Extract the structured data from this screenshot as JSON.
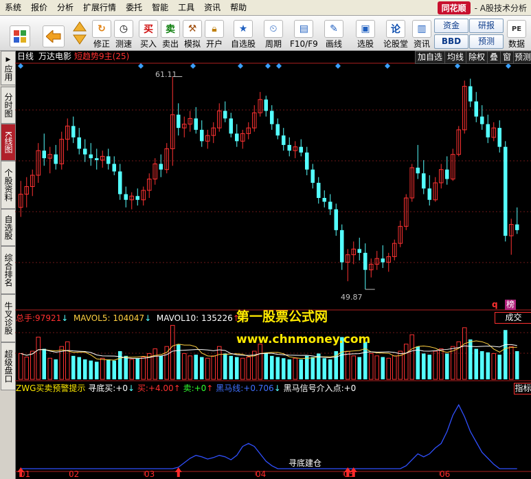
{
  "menu": [
    "系统",
    "报价",
    "分析",
    "扩展行情",
    "委托",
    "智能",
    "工具",
    "资讯",
    "帮助"
  ],
  "app": {
    "logo": "同花顺",
    "title": "- A股技术分析"
  },
  "toolbar": {
    "buttons": [
      "修正",
      "测速",
      "买入",
      "卖出",
      "模拟",
      "开户",
      "自选股",
      "周期",
      "F10/F9",
      "画线",
      "选股",
      "论股堂",
      "资讯",
      "数据"
    ],
    "text_buttons": [
      "资金",
      "研报",
      "BBD",
      "预测"
    ],
    "icons": {
      "buy": "买",
      "sell": "卖",
      "stock_list": "论"
    }
  },
  "sidebar": [
    "应用",
    "分时图",
    "K线图",
    "个股资料",
    "自选股",
    "综合排名",
    "牛叉诊股",
    "超级盘口"
  ],
  "chart_header": {
    "period": "日线",
    "stock": "万达电影",
    "indicator": "短趋势9主(25)"
  },
  "right_buttons": [
    "加自选",
    "均线",
    "除权",
    "叠",
    "窗",
    "预测"
  ],
  "markers": {
    "high": "61.11",
    "low": "49.87",
    "q": "q",
    "bang": "榜"
  },
  "volume": {
    "total_label": "总手:",
    "total": "97921",
    "ma5_label": "MAVOL5:",
    "ma5": "104047",
    "ma10_label": "MAVOL10:",
    "ma10": "135226",
    "panel_title": "成交"
  },
  "indicator": {
    "name": "ZWG买卖预警提示",
    "fields": [
      {
        "label": "寻底买:",
        "value": "+0",
        "color": "#ffffff"
      },
      {
        "label": "买:",
        "value": "+4.00",
        "color": "#ff3030"
      },
      {
        "label": "卖:",
        "value": "+0",
        "color": "#30ff30"
      },
      {
        "label": "黑马线:",
        "value": "+0.706",
        "color": "#4070ff"
      },
      {
        "label": "黑马信号介入点:",
        "value": "+0",
        "color": "#ffffff"
      }
    ],
    "panel_title": "指标",
    "bottom_label": "寻底建仓"
  },
  "x_labels": [
    "01",
    "02",
    "03",
    "04",
    "05",
    "06"
  ],
  "watermark": {
    "cn": "第一股票公式网",
    "url": "www.chnmoney.com"
  },
  "colors": {
    "up": "#ff3232",
    "down": "#54ffff",
    "indicator_line": "#3050ff",
    "bg": "#000000"
  },
  "chart_data": {
    "type": "candlestick",
    "price_range": [
      49.87,
      61.11
    ],
    "candles": [
      {
        "o": 54.2,
        "h": 55.6,
        "l": 53.7,
        "c": 54.9
      },
      {
        "o": 54.9,
        "h": 55.8,
        "l": 54.2,
        "c": 55.3
      },
      {
        "o": 55.3,
        "h": 56.2,
        "l": 54.8,
        "c": 55.9
      },
      {
        "o": 55.9,
        "h": 57.6,
        "l": 55.5,
        "c": 57.2
      },
      {
        "o": 57.2,
        "h": 58.1,
        "l": 56.4,
        "c": 56.8
      },
      {
        "o": 56.8,
        "h": 57.4,
        "l": 56.0,
        "c": 57.0
      },
      {
        "o": 57.0,
        "h": 57.5,
        "l": 56.2,
        "c": 56.5
      },
      {
        "o": 56.5,
        "h": 58.2,
        "l": 56.2,
        "c": 57.8
      },
      {
        "o": 57.8,
        "h": 58.9,
        "l": 57.2,
        "c": 58.5
      },
      {
        "o": 58.5,
        "h": 59.0,
        "l": 57.6,
        "c": 57.9
      },
      {
        "o": 57.9,
        "h": 58.4,
        "l": 57.0,
        "c": 57.3
      },
      {
        "o": 57.3,
        "h": 57.8,
        "l": 56.6,
        "c": 57.0
      },
      {
        "o": 57.0,
        "h": 57.6,
        "l": 56.4,
        "c": 56.8
      },
      {
        "o": 56.8,
        "h": 57.3,
        "l": 56.2,
        "c": 56.7
      },
      {
        "o": 56.7,
        "h": 57.2,
        "l": 56.3,
        "c": 56.9
      },
      {
        "o": 56.9,
        "h": 57.3,
        "l": 56.2,
        "c": 56.5
      },
      {
        "o": 56.5,
        "h": 56.9,
        "l": 55.9,
        "c": 56.1
      },
      {
        "o": 56.1,
        "h": 56.5,
        "l": 54.6,
        "c": 54.9
      },
      {
        "o": 54.9,
        "h": 55.3,
        "l": 54.2,
        "c": 54.6
      },
      {
        "o": 54.6,
        "h": 55.0,
        "l": 54.1,
        "c": 54.8
      },
      {
        "o": 54.8,
        "h": 55.2,
        "l": 54.3,
        "c": 54.6
      },
      {
        "o": 54.6,
        "h": 55.3,
        "l": 54.3,
        "c": 55.1
      },
      {
        "o": 55.1,
        "h": 56.0,
        "l": 54.7,
        "c": 55.7
      },
      {
        "o": 55.7,
        "h": 56.8,
        "l": 55.4,
        "c": 56.5
      },
      {
        "o": 56.5,
        "h": 57.0,
        "l": 55.8,
        "c": 56.2
      },
      {
        "o": 56.2,
        "h": 57.6,
        "l": 56.0,
        "c": 57.3
      },
      {
        "o": 57.3,
        "h": 61.11,
        "l": 56.4,
        "c": 59.1
      },
      {
        "o": 59.1,
        "h": 59.7,
        "l": 58.0,
        "c": 58.4
      },
      {
        "o": 58.4,
        "h": 59.0,
        "l": 57.9,
        "c": 58.6
      },
      {
        "o": 58.6,
        "h": 59.3,
        "l": 58.2,
        "c": 58.9
      },
      {
        "o": 58.9,
        "h": 59.5,
        "l": 58.1,
        "c": 58.3
      },
      {
        "o": 58.3,
        "h": 58.8,
        "l": 57.4,
        "c": 57.7
      },
      {
        "o": 57.7,
        "h": 58.3,
        "l": 57.3,
        "c": 58.0
      },
      {
        "o": 58.0,
        "h": 58.7,
        "l": 57.6,
        "c": 58.4
      },
      {
        "o": 58.4,
        "h": 59.7,
        "l": 58.2,
        "c": 59.3
      },
      {
        "o": 59.3,
        "h": 59.8,
        "l": 58.7,
        "c": 58.9
      },
      {
        "o": 58.9,
        "h": 59.2,
        "l": 57.9,
        "c": 58.1
      },
      {
        "o": 58.1,
        "h": 58.6,
        "l": 57.4,
        "c": 57.7
      },
      {
        "o": 57.7,
        "h": 58.3,
        "l": 57.3,
        "c": 58.1
      },
      {
        "o": 58.1,
        "h": 58.7,
        "l": 57.8,
        "c": 58.4
      },
      {
        "o": 58.4,
        "h": 59.6,
        "l": 58.2,
        "c": 59.2
      },
      {
        "o": 59.2,
        "h": 60.3,
        "l": 59.0,
        "c": 59.9
      },
      {
        "o": 59.9,
        "h": 60.1,
        "l": 59.0,
        "c": 59.3
      },
      {
        "o": 59.3,
        "h": 59.6,
        "l": 58.3,
        "c": 58.6
      },
      {
        "o": 58.6,
        "h": 58.9,
        "l": 57.8,
        "c": 58.0
      },
      {
        "o": 58.0,
        "h": 58.4,
        "l": 57.2,
        "c": 57.5
      },
      {
        "o": 57.5,
        "h": 57.9,
        "l": 56.9,
        "c": 57.2
      },
      {
        "o": 57.2,
        "h": 57.7,
        "l": 56.8,
        "c": 57.4
      },
      {
        "o": 57.4,
        "h": 57.8,
        "l": 56.9,
        "c": 57.1
      },
      {
        "o": 57.1,
        "h": 57.4,
        "l": 55.9,
        "c": 56.2
      },
      {
        "o": 56.2,
        "h": 56.5,
        "l": 55.2,
        "c": 55.5
      },
      {
        "o": 55.5,
        "h": 55.8,
        "l": 54.4,
        "c": 54.7
      },
      {
        "o": 54.7,
        "h": 55.1,
        "l": 54.2,
        "c": 54.5
      },
      {
        "o": 54.5,
        "h": 54.9,
        "l": 53.8,
        "c": 54.1
      },
      {
        "o": 54.1,
        "h": 54.4,
        "l": 52.7,
        "c": 53.0
      },
      {
        "o": 53.0,
        "h": 53.3,
        "l": 50.9,
        "c": 51.3
      },
      {
        "o": 51.3,
        "h": 52.0,
        "l": 50.3,
        "c": 51.7
      },
      {
        "o": 51.7,
        "h": 52.4,
        "l": 51.2,
        "c": 52.0
      },
      {
        "o": 52.0,
        "h": 52.6,
        "l": 51.4,
        "c": 51.8
      },
      {
        "o": 51.8,
        "h": 52.3,
        "l": 49.87,
        "c": 50.9
      },
      {
        "o": 50.9,
        "h": 51.5,
        "l": 50.5,
        "c": 51.2
      },
      {
        "o": 51.2,
        "h": 51.9,
        "l": 50.9,
        "c": 51.5
      },
      {
        "o": 51.5,
        "h": 52.2,
        "l": 51.0,
        "c": 51.3
      },
      {
        "o": 51.3,
        "h": 51.8,
        "l": 50.8,
        "c": 51.6
      },
      {
        "o": 51.6,
        "h": 52.5,
        "l": 51.4,
        "c": 52.3
      },
      {
        "o": 52.3,
        "h": 53.5,
        "l": 52.1,
        "c": 53.2
      },
      {
        "o": 53.2,
        "h": 54.9,
        "l": 53.0,
        "c": 54.7
      },
      {
        "o": 54.7,
        "h": 56.5,
        "l": 54.5,
        "c": 56.3
      },
      {
        "o": 56.3,
        "h": 57.5,
        "l": 55.7,
        "c": 56.0
      },
      {
        "o": 56.0,
        "h": 56.7,
        "l": 54.9,
        "c": 55.2
      },
      {
        "o": 55.2,
        "h": 55.9,
        "l": 54.3,
        "c": 54.6
      },
      {
        "o": 54.6,
        "h": 55.8,
        "l": 54.5,
        "c": 55.5
      },
      {
        "o": 55.5,
        "h": 56.5,
        "l": 55.2,
        "c": 56.2
      },
      {
        "o": 56.2,
        "h": 56.9,
        "l": 55.4,
        "c": 55.7
      },
      {
        "o": 55.7,
        "h": 57.3,
        "l": 55.6,
        "c": 57.0
      },
      {
        "o": 57.0,
        "h": 58.5,
        "l": 56.9,
        "c": 58.3
      },
      {
        "o": 58.3,
        "h": 60.9,
        "l": 58.1,
        "c": 60.6
      },
      {
        "o": 60.6,
        "h": 61.0,
        "l": 59.5,
        "c": 59.8
      },
      {
        "o": 59.8,
        "h": 60.3,
        "l": 58.7,
        "c": 59.0
      },
      {
        "o": 59.0,
        "h": 59.6,
        "l": 58.3,
        "c": 58.6
      },
      {
        "o": 58.6,
        "h": 59.1,
        "l": 57.6,
        "c": 57.9
      },
      {
        "o": 57.9,
        "h": 58.7,
        "l": 57.7,
        "c": 58.4
      },
      {
        "o": 58.4,
        "h": 58.8,
        "l": 57.1,
        "c": 57.4
      },
      {
        "o": 57.4,
        "h": 57.7,
        "l": 52.4,
        "c": 52.7
      },
      {
        "o": 52.7,
        "h": 53.6,
        "l": 51.7,
        "c": 53.3
      },
      {
        "o": 53.3,
        "h": 54.2,
        "l": 52.8,
        "c": 53.0
      }
    ],
    "volume": [
      110,
      95,
      120,
      180,
      130,
      90,
      85,
      140,
      160,
      100,
      95,
      85,
      80,
      75,
      90,
      85,
      80,
      120,
      100,
      85,
      90,
      95,
      110,
      130,
      100,
      140,
      230,
      150,
      110,
      100,
      105,
      95,
      90,
      100,
      140,
      110,
      100,
      95,
      90,
      95,
      120,
      150,
      110,
      100,
      95,
      90,
      85,
      90,
      85,
      100,
      95,
      110,
      90,
      85,
      120,
      180,
      120,
      100,
      95,
      160,
      110,
      100,
      95,
      90,
      100,
      120,
      150,
      190,
      140,
      110,
      105,
      120,
      130,
      110,
      140,
      160,
      220,
      170,
      130,
      120,
      115,
      110,
      105,
      210,
      140,
      120
    ],
    "indicator_line": [
      0,
      0,
      0,
      0,
      0,
      0,
      0,
      0,
      0,
      0,
      0,
      0,
      0,
      0,
      0,
      0,
      0,
      0,
      0,
      0,
      0,
      0,
      0,
      0,
      0,
      0,
      0,
      0.02,
      0.08,
      0.14,
      0.18,
      0.16,
      0.13,
      0.15,
      0.18,
      0.16,
      0.12,
      0.18,
      0.3,
      0.34,
      0.3,
      0.2,
      0.1,
      0.04,
      0,
      0,
      0,
      0,
      0,
      0,
      0,
      0,
      0,
      0,
      0,
      0,
      0,
      0,
      0,
      0,
      0,
      0,
      0,
      0,
      0,
      0,
      0.04,
      0.12,
      0.2,
      0.16,
      0.2,
      0.28,
      0.34,
      0.5,
      0.72,
      0.86,
      0.7,
      0.5,
      0.36,
      0.22,
      0.14,
      0.06,
      0,
      0,
      0,
      0
    ],
    "buy_signal_index": [
      0,
      27,
      56,
      57
    ]
  }
}
